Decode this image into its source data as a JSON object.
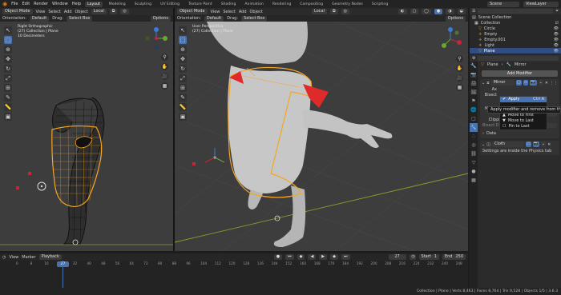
{
  "menubar": {
    "items": [
      "File",
      "Edit",
      "Render",
      "Window",
      "Help"
    ]
  },
  "workspaces": {
    "active": "Layout",
    "tabs": [
      "Layout",
      "Modeling",
      "Sculpting",
      "UV Editing",
      "Texture Paint",
      "Shading",
      "Animation",
      "Rendering",
      "Compositing",
      "Geometry Nodes",
      "Scripting"
    ]
  },
  "scene": {
    "scene_label": "Scene",
    "view_layer_label": "ViewLayer"
  },
  "left_view": {
    "mode": "Object Mode",
    "menus": [
      "View",
      "Select",
      "Add",
      "Object"
    ],
    "transform": "Local",
    "orientation_label": "Orientation:",
    "orientation_value": "Default",
    "drag_label": "Drag:",
    "drag_value": "Select Box",
    "options": "Options",
    "info": [
      "Right Orthographic",
      "(27) Collection | Plane",
      "10 Decimeters"
    ]
  },
  "right_view": {
    "mode": "Object Mode",
    "menus": [
      "View",
      "Select",
      "Add",
      "Object"
    ],
    "transform": "Local",
    "orientation_label": "Orientation:",
    "orientation_value": "Default",
    "drag_label": "Drag:",
    "drag_value": "Select Box",
    "options": "Options",
    "info": [
      "User Perspective",
      "(27) Collection | Plane"
    ]
  },
  "outliner": {
    "search_placeholder": "",
    "root": "Scene Collection",
    "items": [
      {
        "label": "Collection",
        "selected": false
      },
      {
        "label": "Circle",
        "selected": false
      },
      {
        "label": "Empty",
        "selected": false
      },
      {
        "label": "Empty.001",
        "selected": false
      },
      {
        "label": "Light",
        "selected": false
      },
      {
        "label": "Plane",
        "selected": true
      }
    ]
  },
  "properties": {
    "breadcrumb": [
      "Plane",
      "Mirror"
    ],
    "add_modifier": "Add Modifier",
    "mirror_name": "Mirror",
    "ax_label": "Ax",
    "bisect_label": "Bisect",
    "mirror_obj_label": "Mirror Obj",
    "merge_label": "Me",
    "clipping_label": "Clipping",
    "bisect_distance_label": "Bisect Distance",
    "bisect_distance_value": "0.001 m",
    "data_label": "Data",
    "cloth_name": "Cloth",
    "cloth_note": "Settings are inside the Physics tab",
    "dropdown": {
      "apply": "Apply",
      "apply_shortcut": "Ctrl A",
      "move_first": "Move to First",
      "move_last": "Move to Last",
      "pin_last": "Pin to Last"
    },
    "tooltip": "Apply modifier and remove from the stack"
  },
  "timeline": {
    "menus": [
      "View",
      "Marker",
      "Playback"
    ],
    "current_frame": "27",
    "start_label": "Start",
    "start_value": "1",
    "end_label": "End",
    "end_value": "250",
    "ticks": [
      "0",
      "8",
      "16",
      "24",
      "32",
      "40",
      "48",
      "56",
      "64",
      "72",
      "80",
      "88",
      "96",
      "104",
      "112",
      "120",
      "128",
      "136",
      "144",
      "152",
      "160",
      "168",
      "176",
      "184",
      "192",
      "200",
      "208",
      "216",
      "224",
      "232",
      "240",
      "248"
    ]
  },
  "statusbar": {
    "text": "Collection | Plane | Verts 8,463 | Faces 8,764 | Tris 9,528 | Objects 1/5 | 3.6.3"
  },
  "colors": {
    "accent": "#4772b3",
    "selection": "#f5a623",
    "background": "#3d3d3d",
    "panel": "#2b2b2b"
  }
}
